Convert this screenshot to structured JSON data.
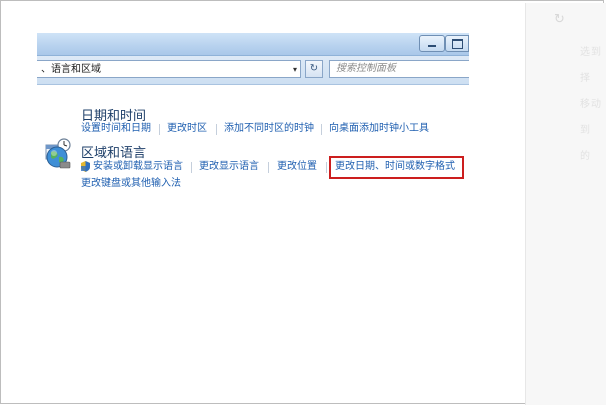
{
  "window": {
    "address_text": "、语言和区域",
    "address_dropdown_glyph": "▾",
    "refresh_glyph": "↻",
    "search_placeholder": "搜索控制面板"
  },
  "categories": [
    {
      "title": "日期和时间",
      "icon": "calendar-clock-icon",
      "links": [
        "设置时间和日期",
        "更改时区",
        "添加不同时区的时钟",
        "向桌面添加时钟小工具"
      ]
    },
    {
      "title": "区域和语言",
      "icon": "globe-icon",
      "links": [
        "安装或卸载显示语言",
        "更改显示语言",
        "更改位置",
        "更改日期、时间或数字格式",
        "更改键盘或其他输入法"
      ]
    }
  ],
  "right_panel": {
    "refresh_glyph": "↻",
    "lines": [
      "选到",
      "择",
      "移动",
      "到",
      "的"
    ]
  },
  "colors": {
    "link": "#1f5fb0",
    "title": "#1e3f69",
    "highlight": "#cc1e1e"
  }
}
